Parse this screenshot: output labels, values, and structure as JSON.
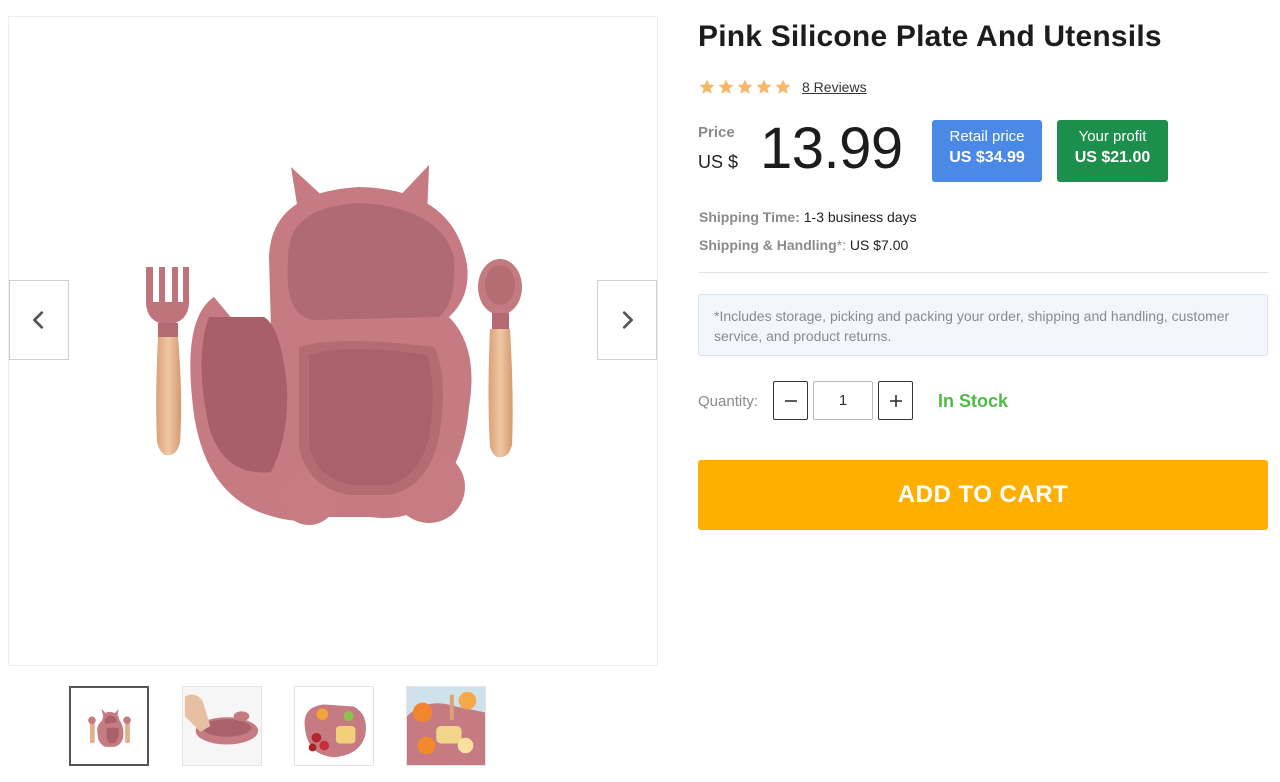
{
  "product": {
    "title": "Pink Silicone Plate And Utensils",
    "rating": 5,
    "reviews_label": "8 Reviews",
    "price_label": "Price",
    "currency": "US $",
    "price": "13.99",
    "retail_label": "Retail price",
    "retail_value": "US $34.99",
    "profit_label": "Your profit",
    "profit_value": "US $21.00"
  },
  "shipping": {
    "time_label": "Shipping Time:",
    "time_value": "1-3 business days",
    "handling_label": "Shipping & Handling",
    "handling_mark": "*:",
    "handling_value": "US $7.00"
  },
  "note": "*Includes storage, picking and packing your order, shipping and handling, customer service, and product returns.",
  "quantity": {
    "label": "Quantity:",
    "value": "1",
    "minus_icon": "minus-icon",
    "plus_icon": "plus-icon"
  },
  "stock_status": "In Stock",
  "cart_button": "ADD TO CART",
  "gallery": {
    "thumbnail_count": 4,
    "active_index": 0,
    "prev_icon": "chevron-left-icon",
    "next_icon": "chevron-right-icon"
  },
  "colors": {
    "star": "#f5b869",
    "retail_bg": "#4a8ae6",
    "profit_bg": "#1c8f4c",
    "in_stock": "#4dbb45",
    "cart_bg": "#feaf01",
    "plate": "#c67b82"
  }
}
